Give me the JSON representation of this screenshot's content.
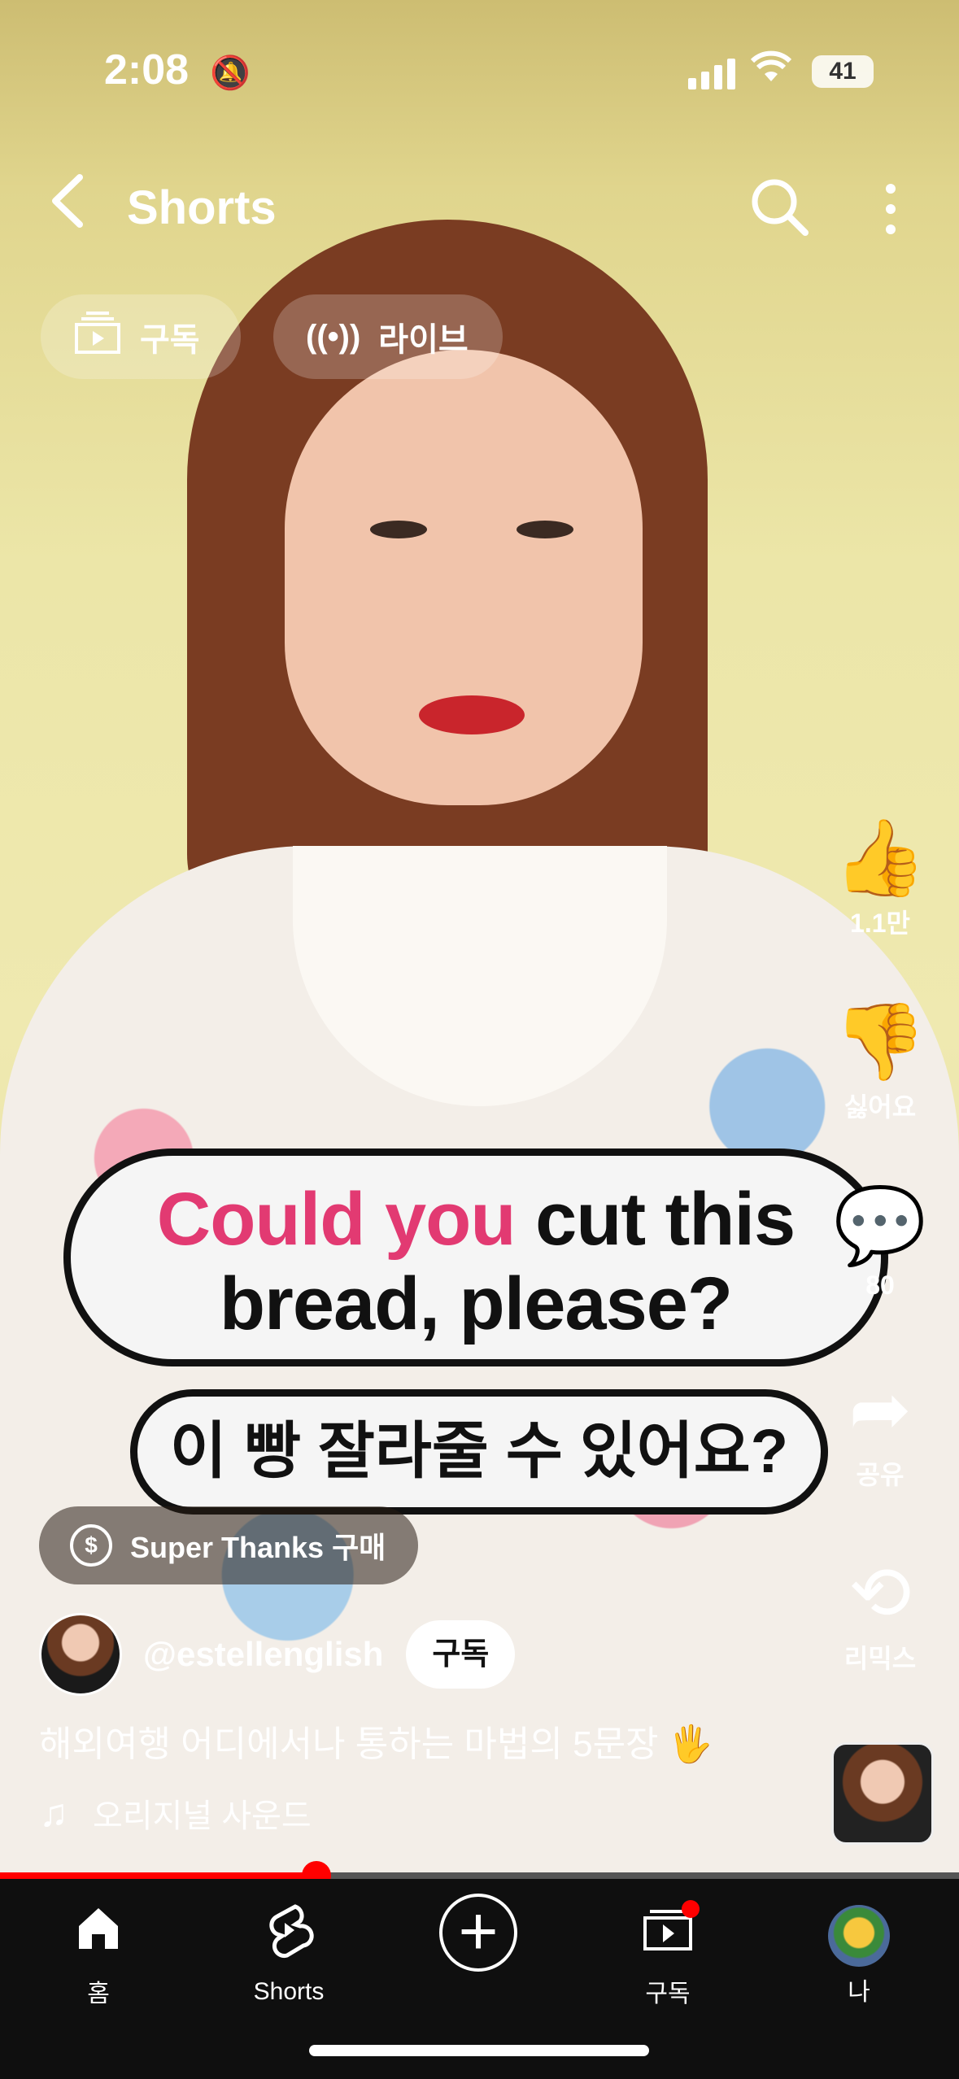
{
  "status": {
    "time": "2:08",
    "battery": "41"
  },
  "header": {
    "title": "Shorts"
  },
  "chips": [
    {
      "label": "구독",
      "icon": "subscriptions-icon"
    },
    {
      "label": "라이브",
      "icon": "live-icon"
    }
  ],
  "caption": {
    "highlight": "Could you",
    "rest": " cut this",
    "line2": "bread, please?",
    "korean": "이 빵 잘라줄 수 있어요?"
  },
  "actions": {
    "like": "1.1만",
    "dislike": "싫어요",
    "comments": "80",
    "share": "공유",
    "remix": "리믹스"
  },
  "super_thanks": "Super Thanks 구매",
  "channel": {
    "handle": "@estellenglish",
    "subscribe": "구독"
  },
  "description": "해외여행 어디에서나 통하는 마법의 5문장 🖐",
  "sound": "오리지널 사운드",
  "progress": 0.33,
  "nav": {
    "home": "홈",
    "shorts": "Shorts",
    "subscriptions": "구독",
    "me": "나"
  },
  "colors": {
    "accent": "#ff0000",
    "caption_highlight": "#e23a72"
  }
}
